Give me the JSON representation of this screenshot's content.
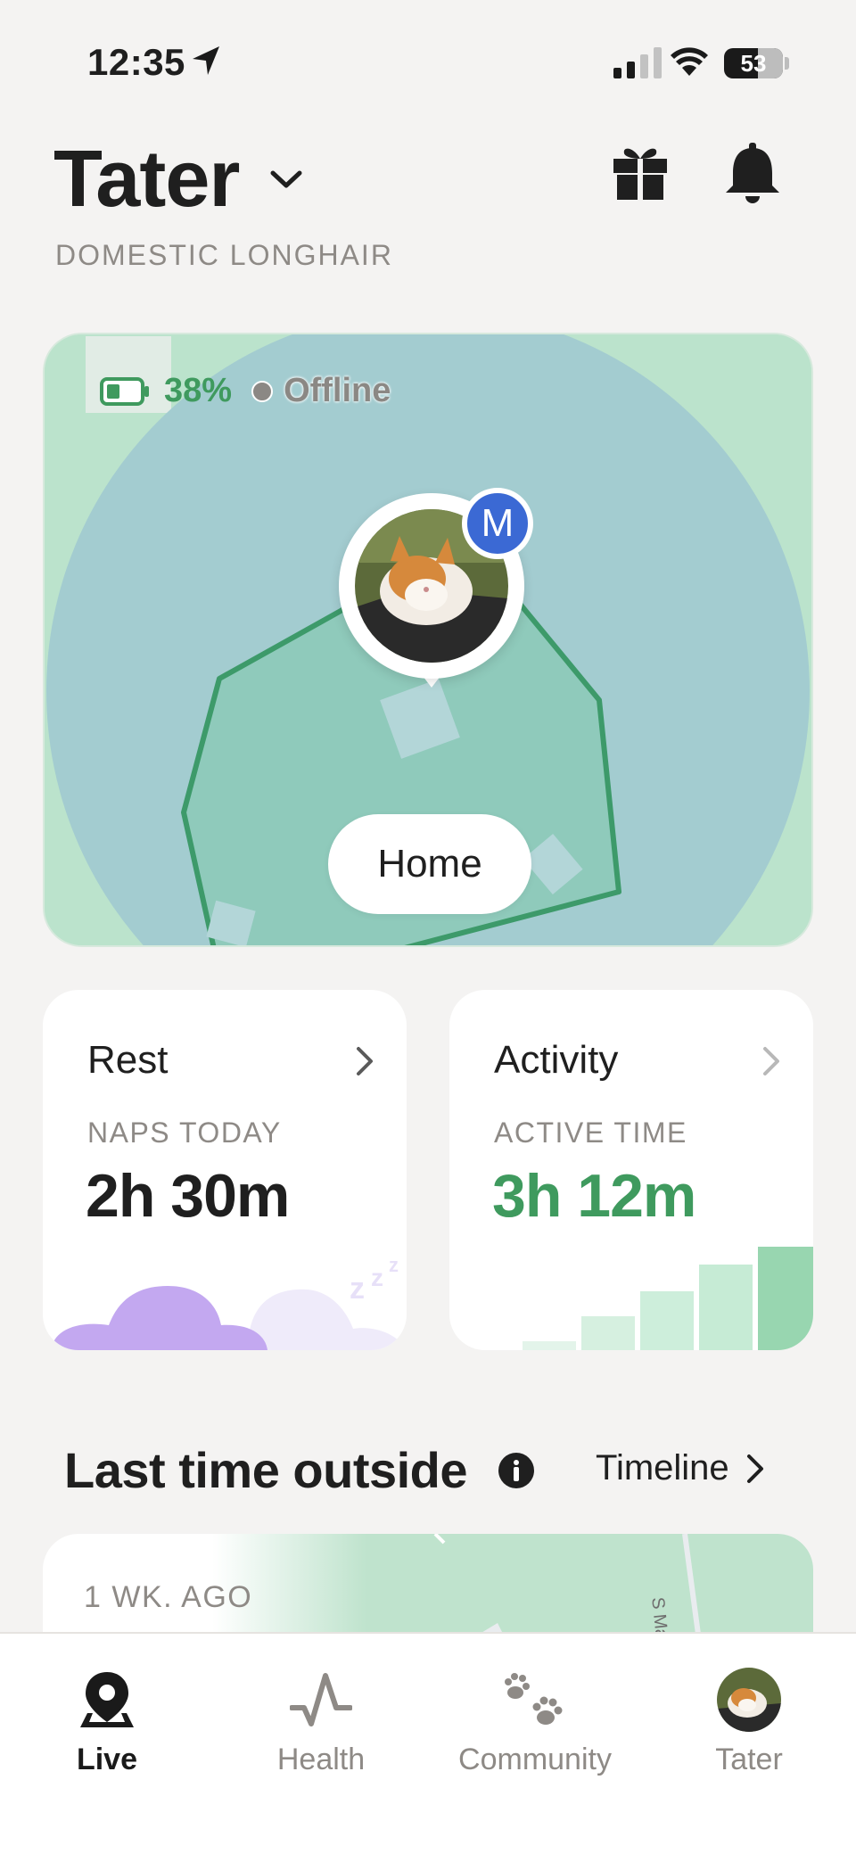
{
  "status_bar": {
    "time": "12:35",
    "battery": "53",
    "icons": [
      "location-arrow-icon",
      "cellular-signal-icon",
      "wifi-icon",
      "battery-icon"
    ]
  },
  "header": {
    "pet_name": "Tater",
    "breed": "DOMESTIC LONGHAIR",
    "icons": [
      "chevron-down-icon",
      "gift-icon",
      "bell-icon"
    ]
  },
  "map": {
    "battery_percent": "38%",
    "connection_status": "Offline",
    "owner_badge": "M",
    "zone_label": "Home",
    "colors": {
      "land": "#bbe3cc",
      "radius": "#a3ccd0",
      "zone": "#8fcabb",
      "zone_border": "#3d9a6a"
    }
  },
  "rest_card": {
    "title": "Rest",
    "label": "NAPS TODAY",
    "value": "2h 30m"
  },
  "activity_card": {
    "title": "Activity",
    "label": "ACTIVE TIME",
    "value": "3h 12m",
    "accent": "#3f9a5e"
  },
  "last_outside": {
    "title": "Last time outside",
    "timeline_label": "Timeline",
    "when": "1 WK. AGO",
    "street": "S Malloy P"
  },
  "tab_bar": {
    "tabs": [
      {
        "label": "Live",
        "icon": "map-pin-icon",
        "active": true
      },
      {
        "label": "Health",
        "icon": "heartbeat-icon",
        "active": false
      },
      {
        "label": "Community",
        "icon": "paw-prints-icon",
        "active": false
      },
      {
        "label": "Tater",
        "icon": "pet-avatar",
        "active": false
      }
    ]
  }
}
